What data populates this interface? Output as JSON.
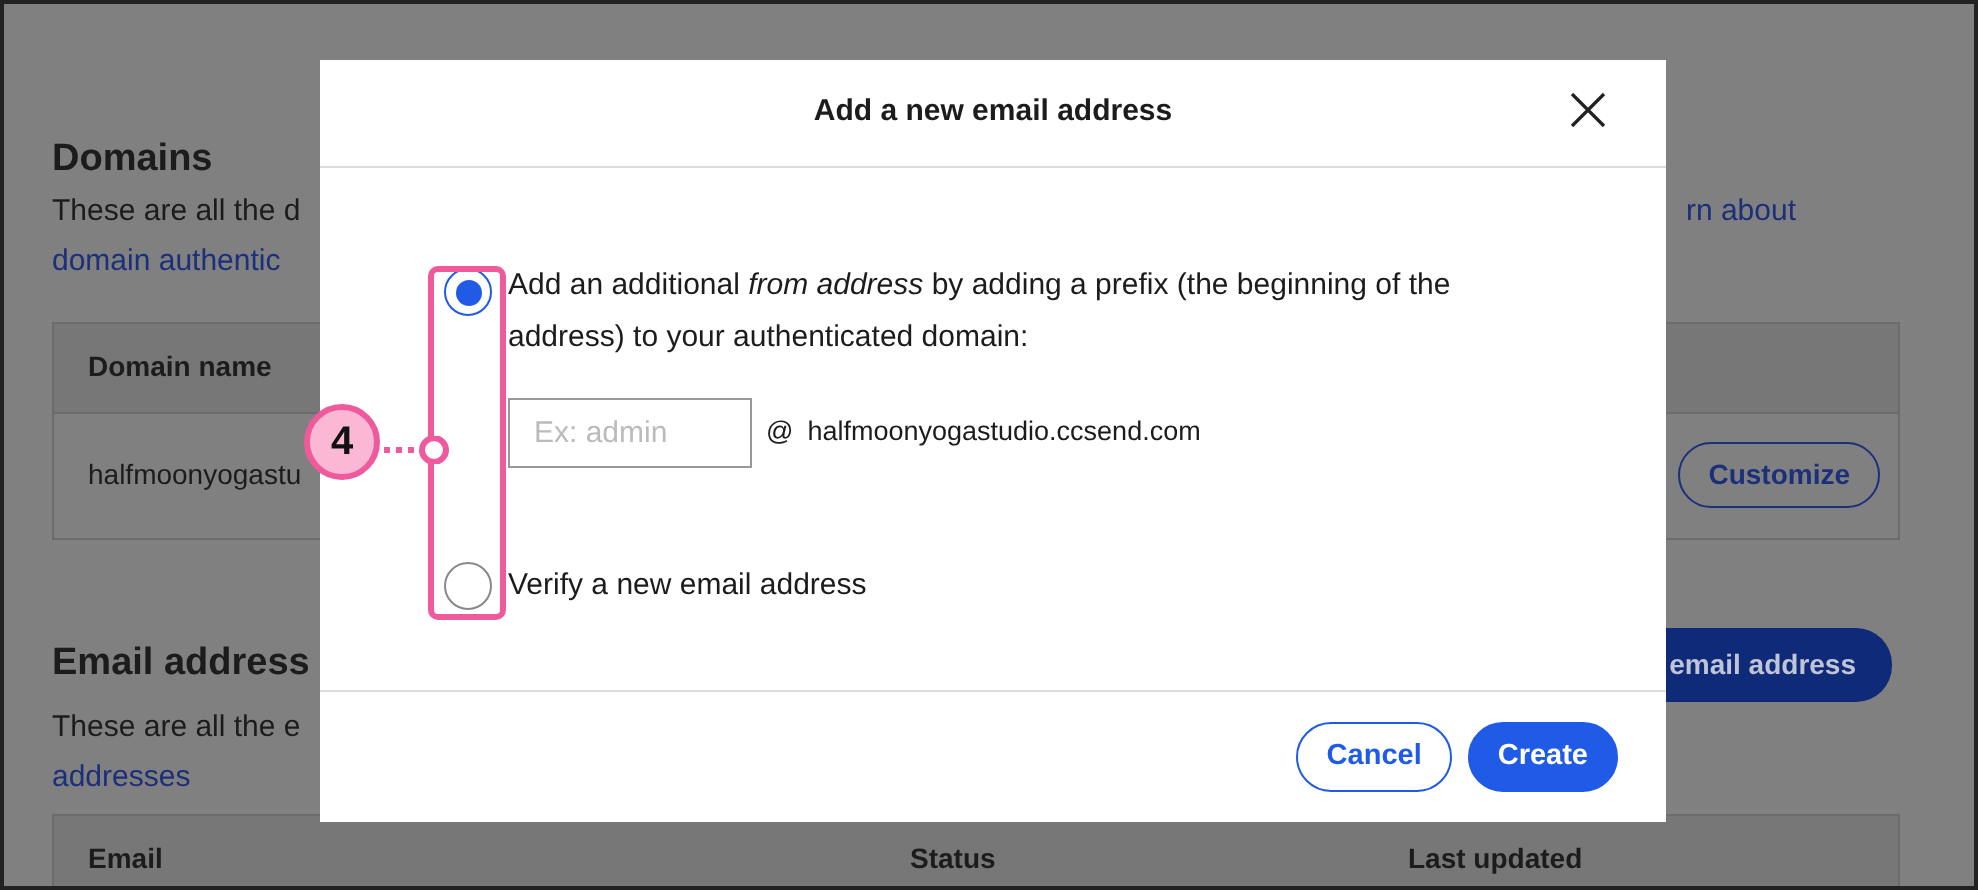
{
  "background": {
    "domains": {
      "heading": "Domains",
      "description": "These are all the d",
      "link_start": "domain authentic",
      "link_end": "rn about",
      "table": {
        "columns": [
          "Domain name"
        ],
        "rows": [
          {
            "domain": "halfmoonyogastu",
            "action": "Customize"
          }
        ]
      }
    },
    "email_addresses": {
      "heading": "Email address",
      "description": "These are all the e",
      "link": "addresses",
      "button": "email address",
      "table": {
        "columns": [
          "Email",
          "Status",
          "Last updated"
        ]
      }
    }
  },
  "modal": {
    "title": "Add a new email address",
    "options": [
      {
        "kind": "prefix",
        "label": "Add an additional *from address* by adding a prefix (the beginning of the address) to your authenticated domain:",
        "selected": true,
        "placeholder": "Ex: admin",
        "at": "@",
        "domain": "halfmoonyogastudio.ccsend.com"
      },
      {
        "kind": "verify",
        "label": "Verify a new email address",
        "selected": false
      }
    ],
    "buttons": [
      {
        "label": "Cancel",
        "kind": "secondary"
      },
      {
        "label": "Create",
        "kind": "primary"
      }
    ]
  },
  "callout": {
    "label": "4"
  }
}
